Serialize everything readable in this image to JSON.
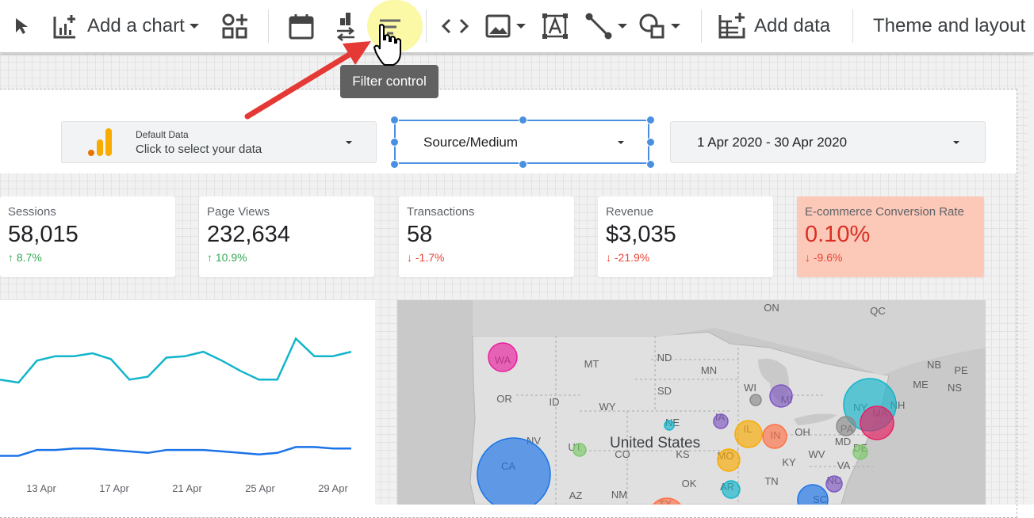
{
  "toolbar": {
    "add_chart_label": "Add a chart",
    "add_data_label": "Add data",
    "theme_layout_label": "Theme and layout",
    "tooltip": "Filter control"
  },
  "controls": {
    "data_source": {
      "title": "Default Data",
      "subtitle": "Click to select your data"
    },
    "filter": {
      "label": "Source/Medium"
    },
    "date_range": {
      "label": "1 Apr 2020 - 30 Apr 2020"
    }
  },
  "scorecards": [
    {
      "label": "Sessions",
      "value": "58,015",
      "delta": "8.7%",
      "direction": "up"
    },
    {
      "label": "Page Views",
      "value": "232,634",
      "delta": "10.9%",
      "direction": "up"
    },
    {
      "label": "Transactions",
      "value": "58",
      "delta": "-1.7%",
      "direction": "down"
    },
    {
      "label": "Revenue",
      "value": "$3,035",
      "delta": "-21.9%",
      "direction": "down"
    },
    {
      "label": "E-commerce Conversion Rate",
      "value": "0.10%",
      "delta": "-9.6%",
      "direction": "down"
    }
  ],
  "chart_data": {
    "type": "line",
    "x_ticks": [
      "13 Apr",
      "17 Apr",
      "21 Apr",
      "25 Apr",
      "29 Apr"
    ],
    "series": [
      {
        "color": "#12b5cb",
        "values": [
          0.62,
          0.6,
          0.75,
          0.78,
          0.78,
          0.8,
          0.76,
          0.62,
          0.64,
          0.77,
          0.78,
          0.81,
          0.75,
          0.68,
          0.62,
          0.62,
          0.9,
          0.78,
          0.78,
          0.81
        ]
      },
      {
        "color": "#1a73e8",
        "values": [
          0.1,
          0.1,
          0.14,
          0.14,
          0.15,
          0.15,
          0.14,
          0.13,
          0.12,
          0.14,
          0.14,
          0.14,
          0.13,
          0.12,
          0.11,
          0.12,
          0.16,
          0.16,
          0.15,
          0.15
        ]
      }
    ]
  },
  "map": {
    "country_label": "United States",
    "regions": [
      "ON",
      "QC",
      "MT",
      "ND",
      "MN",
      "SD",
      "WY",
      "ID",
      "OR",
      "NV",
      "UT",
      "CO",
      "KS",
      "NE",
      "NM",
      "AZ",
      "OK",
      "TX",
      "MO",
      "AR",
      "IL",
      "IN",
      "OH",
      "KY",
      "WV",
      "VA",
      "TN",
      "NC",
      "SC",
      "MD",
      "DE",
      "PA",
      "NY",
      "NH",
      "MA",
      "ME",
      "NB",
      "PE",
      "NS",
      "WI",
      "MI",
      "IA",
      "CA",
      "WA"
    ],
    "bubbles": [
      {
        "state": "WA",
        "color": "#e91e9c"
      },
      {
        "state": "CA",
        "color": "#1a73e8"
      },
      {
        "state": "UT",
        "color": "#7cc96a"
      },
      {
        "state": "NE",
        "color": "#12b5cb"
      },
      {
        "state": "IA",
        "color": "#7e57c2"
      },
      {
        "state": "MI",
        "color": "#7e57c2"
      },
      {
        "state": "WI",
        "color": "#8a8a8a"
      },
      {
        "state": "IL",
        "color": "#f9ab00"
      },
      {
        "state": "IN",
        "color": "#ff7043"
      },
      {
        "state": "MO",
        "color": "#f9ab00"
      },
      {
        "state": "AR",
        "color": "#12b5cb"
      },
      {
        "state": "NY",
        "color": "#12b5cb"
      },
      {
        "state": "MA",
        "color": "#e91e63"
      },
      {
        "state": "PA",
        "color": "#8a8a8a"
      },
      {
        "state": "DE",
        "color": "#7cc96a"
      },
      {
        "state": "NC",
        "color": "#7e57c2"
      },
      {
        "state": "SC",
        "color": "#1a73e8"
      },
      {
        "state": "TX",
        "color": "#ff7043"
      }
    ]
  }
}
